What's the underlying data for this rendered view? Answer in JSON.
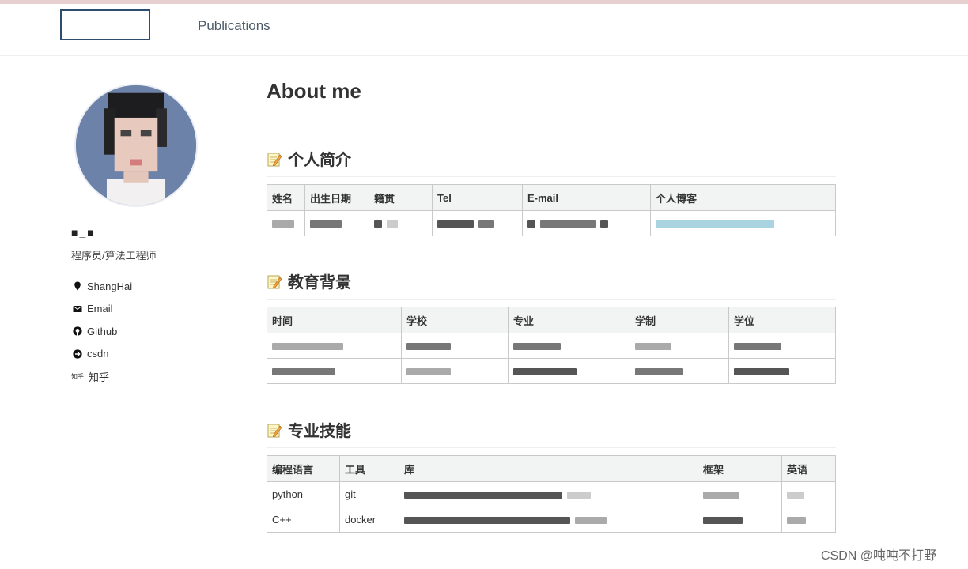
{
  "header": {
    "nav_publications": "Publications"
  },
  "sidebar": {
    "author_name": "■_■",
    "author_bio": "程序员/算法工程师",
    "links": [
      {
        "icon": "location-pin-icon",
        "label": "ShangHai"
      },
      {
        "icon": "envelope-icon",
        "label": "Email"
      },
      {
        "icon": "github-icon",
        "label": "Github"
      },
      {
        "icon": "arrow-circle-icon",
        "label": "csdn"
      },
      {
        "icon": "zhihu-icon",
        "label": "知乎",
        "mark": "知乎"
      }
    ]
  },
  "main": {
    "title": "About me",
    "sections": [
      {
        "heading": "个人简介",
        "icon": "memo-icon",
        "columns": [
          "姓名",
          "出生日期",
          "籍贯",
          "Tel",
          "E-mail",
          "个人博客"
        ]
      },
      {
        "heading": "教育背景",
        "icon": "memo-icon",
        "columns": [
          "时间",
          "学校",
          "专业",
          "学制",
          "学位"
        ]
      },
      {
        "heading": "专业技能",
        "icon": "memo-icon",
        "columns": [
          "编程语言",
          "工具",
          "库",
          "框架",
          "英语"
        ],
        "rows": [
          {
            "lang": "python",
            "tool": "git"
          },
          {
            "lang": "C++",
            "tool": "docker"
          }
        ]
      }
    ]
  },
  "watermark": "CSDN @吨吨不打野",
  "colors": {
    "nav_box_border": "#2d4d6e",
    "table_header_bg": "#f2f3f3",
    "table_border": "#c9c9c9",
    "top_line": "#e7cfcf"
  }
}
